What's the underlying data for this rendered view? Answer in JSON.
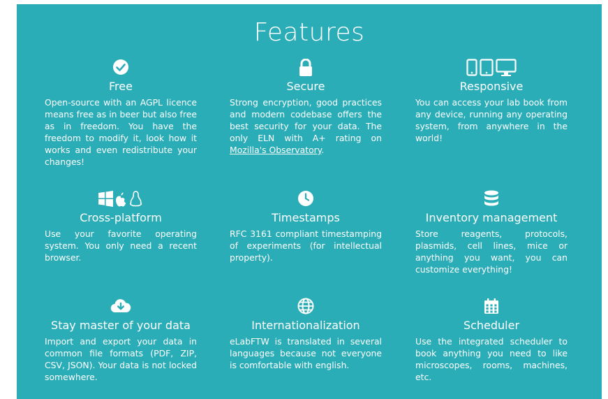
{
  "header": {
    "title": "Features"
  },
  "features": [
    {
      "icon": "check-circle-icon",
      "title": "Free",
      "desc": "Open-source with an AGPL licence means free as in beer but also free as in freedom. You have the freedom to modify it, look how it works and even redistribute your changes!"
    },
    {
      "icon": "lock-icon",
      "title": "Secure",
      "desc_pre": "Strong encryption, good practices and modern codebase offers the best security for your data. The only ELN with A+ rating on ",
      "link": "Mozilla's Observatory",
      "desc_post": "."
    },
    {
      "icon": "devices-icon",
      "title": "Responsive",
      "desc": "You can access your lab book from any device, running any operating system, from anywhere in the world!"
    },
    {
      "icon": "os-logos-icon",
      "title": "Cross-platform",
      "desc": "Use your favorite operating system. You only need a recent browser."
    },
    {
      "icon": "clock-icon",
      "title": "Timestamps",
      "desc": "RFC 3161 compliant timestamping of experiments (for intellectual property)."
    },
    {
      "icon": "database-icon",
      "title": "Inventory management",
      "desc": "Store reagents, protocols, plasmids, cell lines, mice or anything you want, you can customize everything!"
    },
    {
      "icon": "cloud-download-icon",
      "title": "Stay master of your data",
      "desc": "Import and export your data in common file formats (PDF, ZIP, CSV, JSON). Your data is not locked somewhere."
    },
    {
      "icon": "globe-icon",
      "title": "Internationalization",
      "desc": "eLabFTW is translated in several languages because not everyone is comfortable with english."
    },
    {
      "icon": "calendar-icon",
      "title": "Scheduler",
      "desc": "Use the integrated scheduler to book anything you need to like microscopes, rooms, machines, etc."
    }
  ]
}
